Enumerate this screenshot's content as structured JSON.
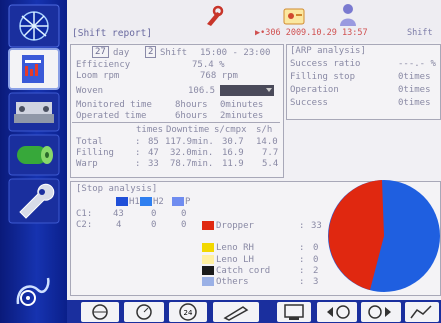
{
  "header": {
    "title": "Shift report",
    "status_text": "▶•306  2009.10.29 13:57",
    "shift_label": "Shift"
  },
  "period": {
    "day_num": "27",
    "day_label": "day",
    "shift_num": "2",
    "shift_label": "Shift",
    "shift_time": "15:00 - 23:00"
  },
  "stats": {
    "efficiency_label": "Efficiency",
    "efficiency_value": "75.4 %",
    "loom_rpm_label": "Loom rpm",
    "loom_rpm_value": "768 rpm",
    "woven_label": "Woven",
    "woven_value": "106.5",
    "monitored_label": "Monitored time",
    "monitored_hours": "8hours",
    "monitored_minutes": "0minutes",
    "operated_label": "Operated time",
    "operated_hours": "6hours",
    "operated_minutes": "2minutes"
  },
  "stop_table": {
    "headers": [
      "times",
      "Downtime",
      "s/cmpx",
      "s/h"
    ],
    "rows": [
      {
        "label": "Total",
        "times": "85",
        "downtime": "117.9min.",
        "scmpx": "30.7",
        "sh": "14.0"
      },
      {
        "label": "Filling",
        "times": "47",
        "downtime": "32.0min.",
        "scmpx": "16.9",
        "sh": "7.7"
      },
      {
        "label": "Warp",
        "times": "33",
        "downtime": "78.7min.",
        "scmpx": "11.9",
        "sh": "5.4"
      }
    ]
  },
  "arp": {
    "title": "ARP analysis",
    "rows": [
      {
        "label": "Success ratio",
        "value": "---.- %"
      },
      {
        "label": "Filling stop",
        "value": "0times"
      },
      {
        "label": "Operation",
        "value": "0times"
      },
      {
        "label": "Success",
        "value": "0times"
      }
    ]
  },
  "stop_analysis": {
    "title": "Stop analysis",
    "legend": [
      "H1",
      "H2",
      "P"
    ],
    "legend_colors": [
      "#1f4fd8",
      "#2f7ff0",
      "#6f8cf0"
    ],
    "rows": [
      {
        "label": "C1:",
        "values": [
          "43",
          "0",
          "0"
        ]
      },
      {
        "label": "C2:",
        "values": [
          "4",
          "0",
          "0"
        ]
      }
    ],
    "items": [
      {
        "name": "Dropper",
        "value": "33",
        "color": "#e02810"
      },
      {
        "name": "Leno RH",
        "value": "0",
        "color": "#f2d800"
      },
      {
        "name": "Leno LH",
        "value": "0",
        "color": "#fff0a0"
      },
      {
        "name": "Catch cord",
        "value": "2",
        "color": "#1a1a1a"
      },
      {
        "name": "Others",
        "value": "3",
        "color": "#9ab0e6"
      }
    ],
    "pie_colors": {
      "c1": "#1f5fe0",
      "dropper": "#e02810"
    }
  },
  "nav": {
    "icons": [
      "logo-icon",
      "report-icon",
      "loom-icon",
      "fabric-roll-icon",
      "wrench-icon",
      "settings-icon"
    ]
  },
  "toolbar": {
    "icons": [
      "steering-wheel-icon",
      "gauge-icon",
      "counter-24-icon",
      "tool-icon",
      "monitor-icon",
      "prev-page-icon",
      "next-page-icon",
      "graph-icon"
    ]
  }
}
